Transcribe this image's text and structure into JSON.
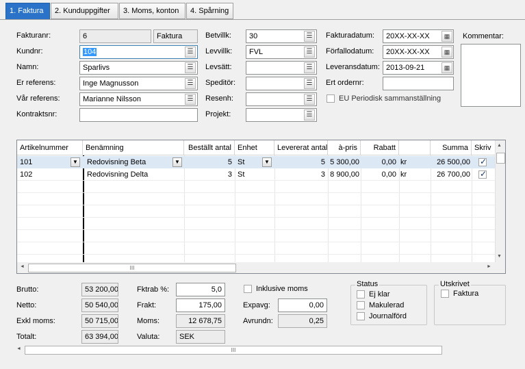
{
  "tabs": [
    {
      "label": "1. Faktura"
    },
    {
      "label": "2. Kunduppgifter"
    },
    {
      "label": "3. Moms, konton"
    },
    {
      "label": "4. Spårning"
    }
  ],
  "head": {
    "fakturanr_label": "Fakturanr:",
    "fakturanr": "6",
    "fakturatyp": "Faktura",
    "kundnr_label": "Kundnr:",
    "kundnr": "104",
    "namn_label": "Namn:",
    "namn": "Sparlivs",
    "er_ref_label": "Er referens:",
    "er_ref": "Inge Magnusson",
    "var_ref_label": "Vår referens:",
    "var_ref": "Marianne Nilsson",
    "kontrakt_label": "Kontraktsnr:",
    "kontrakt": "",
    "betvillk_label": "Betvillk:",
    "betvillk": "30",
    "levvillk_label": "Levvillk:",
    "levvillk": "FVL",
    "levsatt_label": "Levsätt:",
    "levsatt": "",
    "speditor_label": "Speditör:",
    "speditor": "",
    "resenh_label": "Resenh:",
    "resenh": "",
    "projekt_label": "Projekt:",
    "projekt": "",
    "fakturadatum_label": "Fakturadatum:",
    "fakturadatum": "20XX-XX-XX",
    "forfallodatum_label": "Förfallodatum:",
    "forfallodatum": "20XX-XX-XX",
    "leveransdatum_label": "Leveransdatum:",
    "leveransdatum": "2013-09-21",
    "ert_ordernr_label": "Ert ordernr:",
    "ert_ordernr": "",
    "eu_label": "EU Periodisk sammanställning",
    "kommentar_label": "Kommentar:"
  },
  "grid": {
    "headers": [
      "Artikelnummer",
      "Benämning",
      "Beställt antal",
      "Enhet",
      "Levererat antal",
      "à-pris",
      "Rabatt",
      "",
      "Summa",
      "Skriv"
    ],
    "rows": [
      {
        "art": "101",
        "ben": "Redovisning Beta",
        "best": "5",
        "enhet": "St",
        "lev": "5",
        "apris": "5 300,00",
        "rabatt": "0,00",
        "kr": "kr",
        "summa": "26 500,00",
        "skriv": true
      },
      {
        "art": "102",
        "ben": "Redovisning Delta",
        "best": "3",
        "enhet": "St",
        "lev": "3",
        "apris": "8 900,00",
        "rabatt": "0,00",
        "kr": "kr",
        "summa": "26 700,00",
        "skriv": true
      }
    ],
    "hscroll_thumb": "III"
  },
  "totals": {
    "brutto_label": "Brutto:",
    "brutto": "53 200,00",
    "netto_label": "Netto:",
    "netto": "50 540,00",
    "exkl_label": "Exkl moms:",
    "exkl": "50 715,00",
    "totalt_label": "Totalt:",
    "totalt": "63 394,00",
    "fktrab_label": "Fktrab %:",
    "fktrab": "5,0",
    "frakt_label": "Frakt:",
    "frakt": "175,00",
    "moms_label": "Moms:",
    "moms": "12 678,75",
    "valuta_label": "Valuta:",
    "valuta": "SEK",
    "inkl_moms_label": "Inklusive moms",
    "expavg_label": "Expavg:",
    "expavg": "0,00",
    "avrundn_label": "Avrundn:",
    "avrundn": "0,25"
  },
  "status": {
    "title": "Status",
    "ej_klar": "Ej klar",
    "makulerad": "Makulerad",
    "journalford": "Journalförd"
  },
  "utskrivet": {
    "title": "Utskrivet",
    "faktura": "Faktura"
  },
  "bottom_scroll_thumb": "III"
}
